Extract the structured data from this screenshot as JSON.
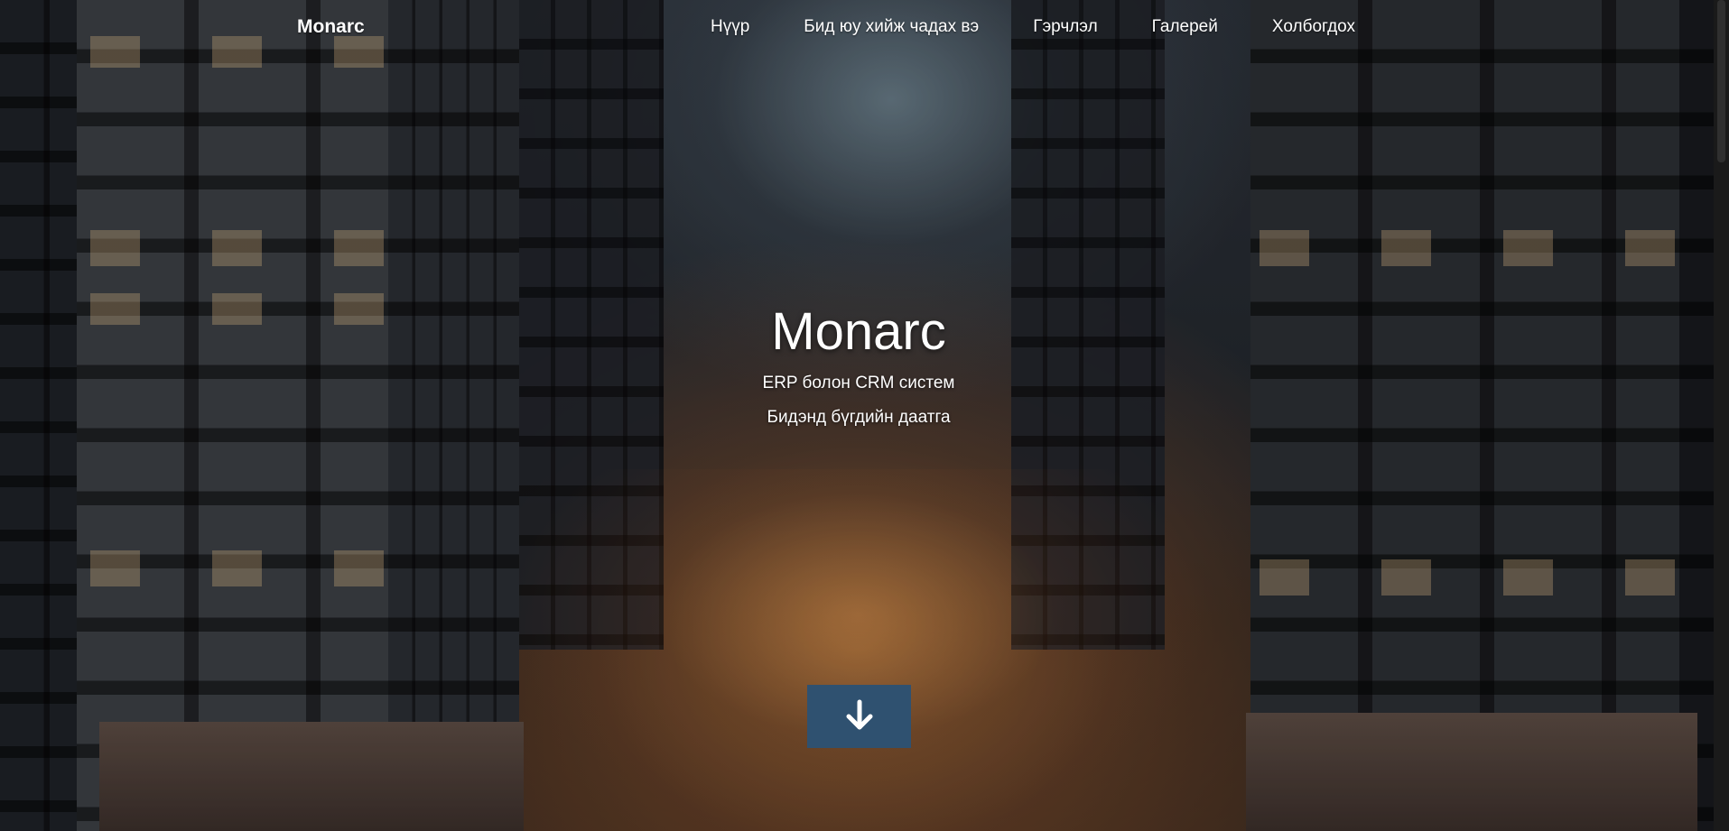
{
  "nav": {
    "brand": "Monarc",
    "links": [
      {
        "label": "Нүүр"
      },
      {
        "label": "Бид юу хийж чадах вэ"
      },
      {
        "label": "Гэрчлэл"
      },
      {
        "label": "Галерей"
      },
      {
        "label": "Холбогдох"
      }
    ]
  },
  "hero": {
    "title": "Monarc",
    "subtitle": "ERP болон CRM систем",
    "tagline": "Бидэнд бүгдийн даатга",
    "scroll_icon": "arrow-down-icon"
  },
  "colors": {
    "button_bg": "#2f5170",
    "text": "#ffffff"
  }
}
